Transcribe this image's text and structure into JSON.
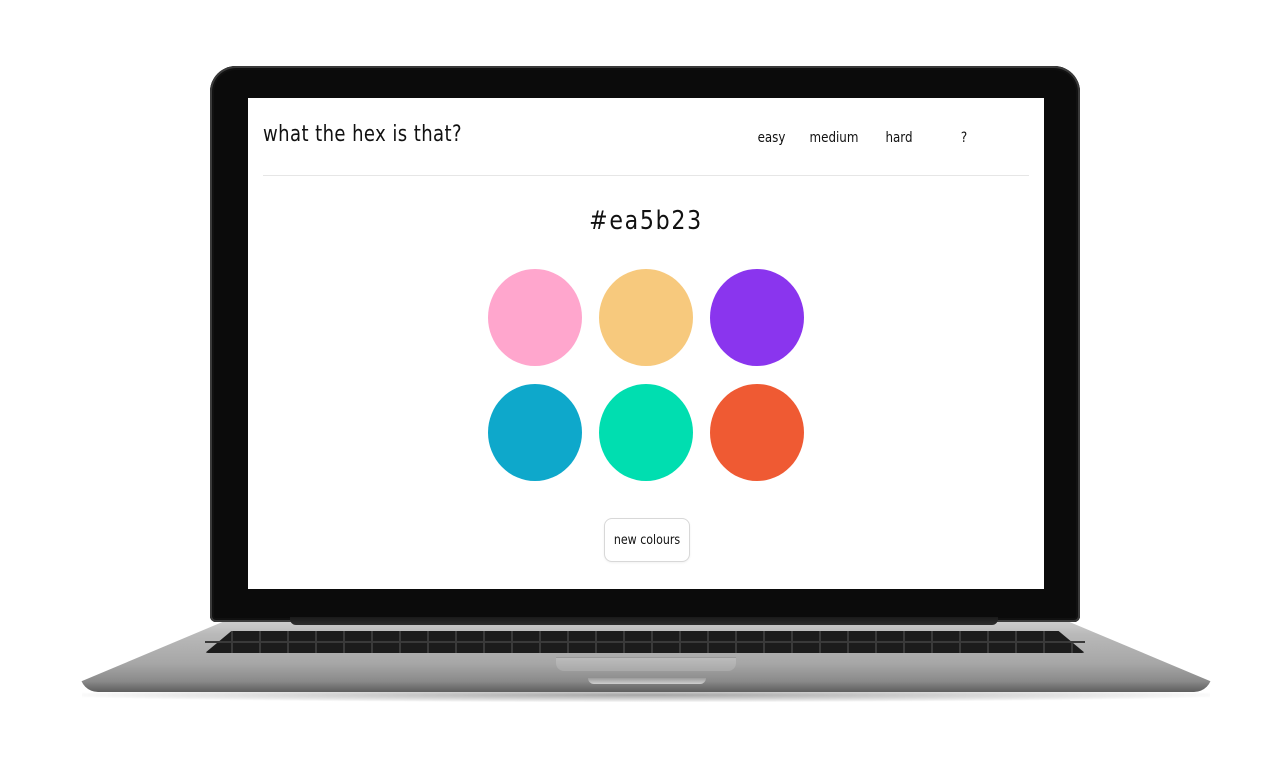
{
  "app": {
    "title": "what the hex is that?"
  },
  "nav": {
    "items": [
      {
        "label": "easy"
      },
      {
        "label": "medium"
      },
      {
        "label": "hard"
      },
      {
        "label": "?"
      }
    ]
  },
  "game": {
    "target_hex": "#ea5b23",
    "swatch_colors": [
      "#ffa6cd",
      "#f7c97d",
      "#8a35ee",
      "#0ea8cb",
      "#00deb0",
      "#ef5a33"
    ],
    "new_button_label": "new colours"
  }
}
